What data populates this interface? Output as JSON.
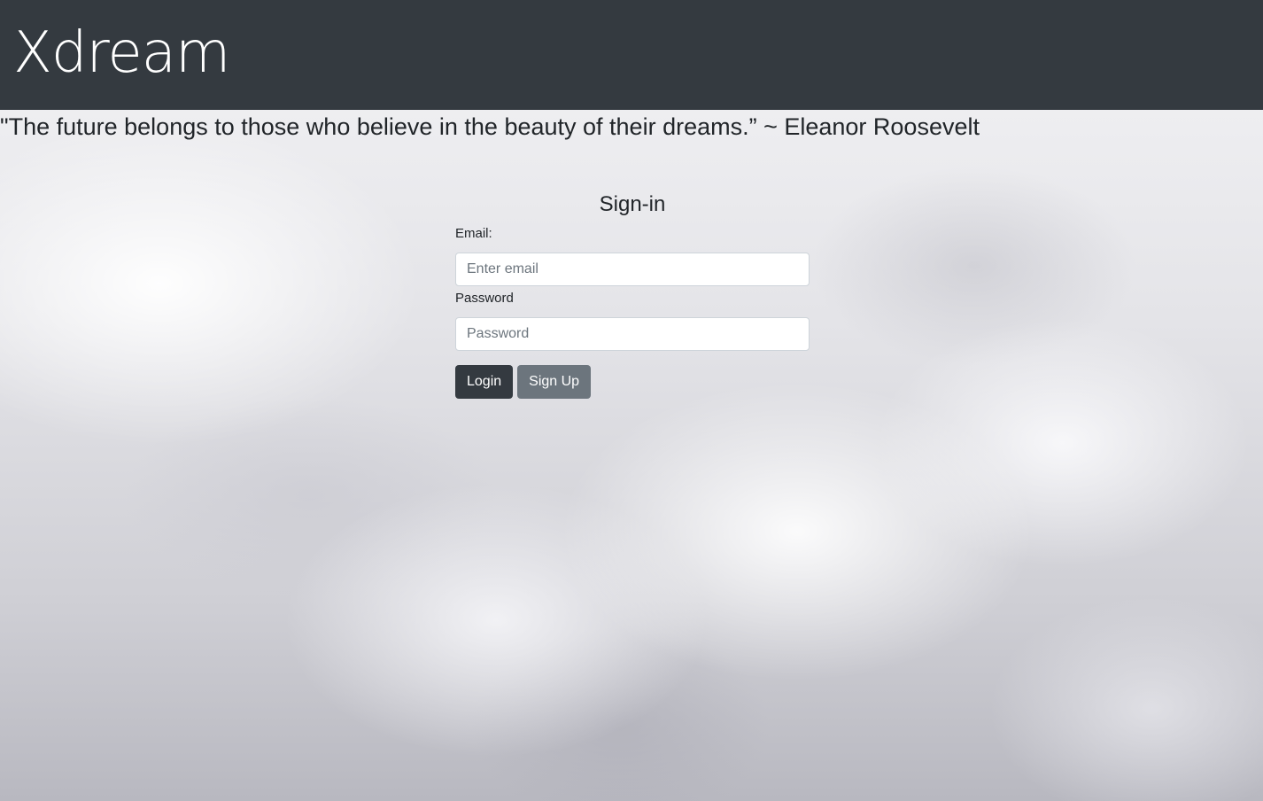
{
  "navbar": {
    "brand": "Xdream",
    "background": "#343a40"
  },
  "quote": {
    "text": "\"The future belongs to those who believe in the beauty of their dreams.” ~ Eleanor Roosevelt"
  },
  "signin": {
    "title": "Sign-in",
    "email_label": "Email:",
    "email_placeholder": "Enter email",
    "email_value": "",
    "password_label": "Password",
    "password_placeholder": "Password",
    "password_value": "",
    "login_label": "Login",
    "signup_label": "Sign Up"
  },
  "colors": {
    "dark": "#343a40",
    "secondary": "#6c757d"
  }
}
